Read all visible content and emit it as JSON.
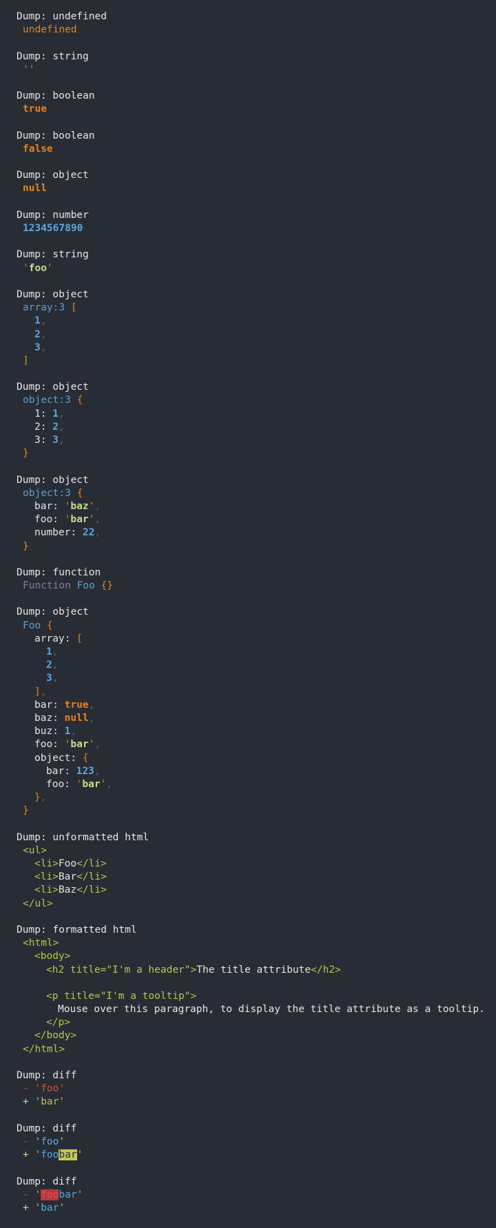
{
  "dumps": [
    {
      "title": "Dump: undefined",
      "lines": [
        {
          "i": 1,
          "t": [
            [
              "undef",
              "undefined"
            ]
          ]
        }
      ]
    },
    {
      "title": "Dump: string",
      "lines": [
        {
          "i": 1,
          "t": [
            [
              "q",
              "''"
            ]
          ]
        }
      ]
    },
    {
      "title": "Dump: boolean",
      "lines": [
        {
          "i": 1,
          "t": [
            [
              "kw",
              "true"
            ]
          ]
        }
      ]
    },
    {
      "title": "Dump: boolean",
      "lines": [
        {
          "i": 1,
          "t": [
            [
              "kw",
              "false"
            ]
          ]
        }
      ]
    },
    {
      "title": "Dump: object",
      "lines": [
        {
          "i": 1,
          "t": [
            [
              "kw",
              "null"
            ]
          ]
        }
      ]
    },
    {
      "title": "Dump: number",
      "lines": [
        {
          "i": 1,
          "t": [
            [
              "num",
              "1234567890"
            ]
          ]
        }
      ]
    },
    {
      "title": "Dump: string",
      "lines": [
        {
          "i": 1,
          "t": [
            [
              "q",
              "'"
            ],
            [
              "str",
              "foo"
            ],
            [
              "q",
              "'"
            ]
          ]
        }
      ]
    },
    {
      "title": "Dump: object",
      "lines": [
        {
          "i": 1,
          "t": [
            [
              "type",
              "array:3 "
            ],
            [
              "br",
              "["
            ]
          ]
        },
        {
          "i": 2,
          "t": [
            [
              "num",
              "1"
            ],
            [
              "cm",
              ","
            ]
          ]
        },
        {
          "i": 2,
          "t": [
            [
              "num",
              "2"
            ],
            [
              "cm",
              ","
            ]
          ]
        },
        {
          "i": 2,
          "t": [
            [
              "num",
              "3"
            ],
            [
              "cm",
              ","
            ]
          ]
        },
        {
          "i": 1,
          "t": [
            [
              "br",
              "]"
            ]
          ]
        }
      ]
    },
    {
      "title": "Dump: object",
      "lines": [
        {
          "i": 1,
          "t": [
            [
              "type",
              "object:3 "
            ],
            [
              "br",
              "{"
            ]
          ]
        },
        {
          "i": 2,
          "t": [
            [
              "w",
              "1: "
            ],
            [
              "num",
              "1"
            ],
            [
              "cm",
              ","
            ]
          ]
        },
        {
          "i": 2,
          "t": [
            [
              "w",
              "2: "
            ],
            [
              "num",
              "2"
            ],
            [
              "cm",
              ","
            ]
          ]
        },
        {
          "i": 2,
          "t": [
            [
              "w",
              "3: "
            ],
            [
              "num",
              "3"
            ],
            [
              "cm",
              ","
            ]
          ]
        },
        {
          "i": 1,
          "t": [
            [
              "br",
              "}"
            ]
          ]
        }
      ]
    },
    {
      "title": "Dump: object",
      "lines": [
        {
          "i": 1,
          "t": [
            [
              "type",
              "object:3 "
            ],
            [
              "br",
              "{"
            ]
          ]
        },
        {
          "i": 2,
          "t": [
            [
              "w",
              "bar: "
            ],
            [
              "q",
              "'"
            ],
            [
              "str",
              "baz"
            ],
            [
              "q",
              "'"
            ],
            [
              "cm",
              ","
            ]
          ]
        },
        {
          "i": 2,
          "t": [
            [
              "w",
              "foo: "
            ],
            [
              "q",
              "'"
            ],
            [
              "str",
              "bar"
            ],
            [
              "q",
              "'"
            ],
            [
              "cm",
              ","
            ]
          ]
        },
        {
          "i": 2,
          "t": [
            [
              "w",
              "number: "
            ],
            [
              "num",
              "22"
            ],
            [
              "cm",
              ","
            ]
          ]
        },
        {
          "i": 1,
          "t": [
            [
              "br",
              "}"
            ]
          ]
        }
      ]
    },
    {
      "title": "Dump: function",
      "lines": [
        {
          "i": 1,
          "t": [
            [
              "fnkw",
              "Function "
            ],
            [
              "type",
              "Foo "
            ],
            [
              "br",
              "{}"
            ]
          ]
        }
      ]
    },
    {
      "title": "Dump: object",
      "lines": [
        {
          "i": 1,
          "t": [
            [
              "type",
              "Foo "
            ],
            [
              "br",
              "{"
            ]
          ]
        },
        {
          "i": 2,
          "t": [
            [
              "w",
              "array: "
            ],
            [
              "br",
              "["
            ]
          ]
        },
        {
          "i": 3,
          "t": [
            [
              "num",
              "1"
            ],
            [
              "cm",
              ","
            ]
          ]
        },
        {
          "i": 3,
          "t": [
            [
              "num",
              "2"
            ],
            [
              "cm",
              ","
            ]
          ]
        },
        {
          "i": 3,
          "t": [
            [
              "num",
              "3"
            ],
            [
              "cm",
              ","
            ]
          ]
        },
        {
          "i": 2,
          "t": [
            [
              "br",
              "]"
            ],
            [
              "cm",
              ","
            ]
          ]
        },
        {
          "i": 2,
          "t": [
            [
              "w",
              "bar: "
            ],
            [
              "kw",
              "true"
            ],
            [
              "cm",
              ","
            ]
          ]
        },
        {
          "i": 2,
          "t": [
            [
              "w",
              "baz: "
            ],
            [
              "kw",
              "null"
            ],
            [
              "cm",
              ","
            ]
          ]
        },
        {
          "i": 2,
          "t": [
            [
              "w",
              "buz: "
            ],
            [
              "num",
              "1"
            ],
            [
              "cm",
              ","
            ]
          ]
        },
        {
          "i": 2,
          "t": [
            [
              "w",
              "foo: "
            ],
            [
              "q",
              "'"
            ],
            [
              "str",
              "bar"
            ],
            [
              "q",
              "'"
            ],
            [
              "cm",
              ","
            ]
          ]
        },
        {
          "i": 2,
          "t": [
            [
              "w",
              "object: "
            ],
            [
              "br",
              "{"
            ]
          ]
        },
        {
          "i": 3,
          "t": [
            [
              "w",
              "bar: "
            ],
            [
              "num",
              "123"
            ],
            [
              "cm",
              ","
            ]
          ]
        },
        {
          "i": 3,
          "t": [
            [
              "w",
              "foo: "
            ],
            [
              "q",
              "'"
            ],
            [
              "str",
              "bar"
            ],
            [
              "q",
              "'"
            ],
            [
              "cm",
              ","
            ]
          ]
        },
        {
          "i": 2,
          "t": [
            [
              "br",
              "}"
            ],
            [
              "cm",
              ","
            ]
          ]
        },
        {
          "i": 1,
          "t": [
            [
              "br",
              "}"
            ]
          ]
        }
      ]
    },
    {
      "title": "Dump: unformatted html",
      "lines": [
        {
          "i": 1,
          "t": [
            [
              "tag",
              "<ul>"
            ]
          ]
        },
        {
          "i": 2,
          "t": [
            [
              "tag",
              "<li>"
            ],
            [
              "w",
              "Foo"
            ],
            [
              "tag",
              "</li>"
            ]
          ]
        },
        {
          "i": 2,
          "t": [
            [
              "tag",
              "<li>"
            ],
            [
              "w",
              "Bar"
            ],
            [
              "tag",
              "</li>"
            ]
          ]
        },
        {
          "i": 2,
          "t": [
            [
              "tag",
              "<li>"
            ],
            [
              "w",
              "Baz"
            ],
            [
              "tag",
              "</li>"
            ]
          ]
        },
        {
          "i": 1,
          "t": [
            [
              "tag",
              "</ul>"
            ]
          ]
        }
      ]
    },
    {
      "title": "Dump: formatted html",
      "lines": [
        {
          "i": 1,
          "t": [
            [
              "tag",
              "<html>"
            ]
          ]
        },
        {
          "i": 2,
          "t": [
            [
              "tag",
              "<body>"
            ]
          ]
        },
        {
          "i": 3,
          "t": [
            [
              "tag",
              "<h2 title=\"I'm a header\">"
            ],
            [
              "w",
              "The title attribute"
            ],
            [
              "tag",
              "</h2>"
            ]
          ]
        },
        {
          "i": 3,
          "t": []
        },
        {
          "i": 3,
          "t": [
            [
              "tag",
              "<p title=\"I'm a tooltip\">"
            ]
          ]
        },
        {
          "i": 4,
          "t": [
            [
              "w",
              "Mouse over this paragraph, to display the title attribute as a tooltip."
            ]
          ]
        },
        {
          "i": 3,
          "t": [
            [
              "tag",
              "</p>"
            ]
          ]
        },
        {
          "i": 2,
          "t": [
            [
              "tag",
              "</body>"
            ]
          ]
        },
        {
          "i": 1,
          "t": [
            [
              "tag",
              "</html>"
            ]
          ]
        }
      ]
    },
    {
      "title": "Dump: diff",
      "lines": [
        {
          "i": 1,
          "t": [
            [
              "dm",
              "- "
            ],
            [
              "dm",
              "'foo'"
            ]
          ]
        },
        {
          "i": 1,
          "t": [
            [
              "dp",
              "+ "
            ],
            [
              "dq",
              "'"
            ],
            [
              "dq",
              "bar"
            ],
            [
              "dq",
              "'"
            ]
          ]
        }
      ]
    },
    {
      "title": "Dump: diff",
      "lines": [
        {
          "i": 1,
          "t": [
            [
              "dm",
              "- "
            ],
            [
              "dq",
              "'"
            ],
            [
              "ds",
              "foo"
            ],
            [
              "dq",
              "'"
            ]
          ]
        },
        {
          "i": 1,
          "t": [
            [
              "dp",
              "+ "
            ],
            [
              "dq",
              "'"
            ],
            [
              "ds",
              "foo"
            ],
            [
              "hl-add",
              "bar"
            ],
            [
              "dq",
              "'"
            ]
          ]
        }
      ]
    },
    {
      "title": "Dump: diff",
      "lines": [
        {
          "i": 1,
          "t": [
            [
              "dm",
              "- "
            ],
            [
              "dq",
              "'"
            ],
            [
              "hl-del",
              "foo"
            ],
            [
              "ds",
              "bar"
            ],
            [
              "dq",
              "'"
            ]
          ]
        },
        {
          "i": 1,
          "t": [
            [
              "dp",
              "+ "
            ],
            [
              "dq",
              "'"
            ],
            [
              "ds",
              "bar"
            ],
            [
              "dq",
              "'"
            ]
          ]
        }
      ]
    }
  ]
}
